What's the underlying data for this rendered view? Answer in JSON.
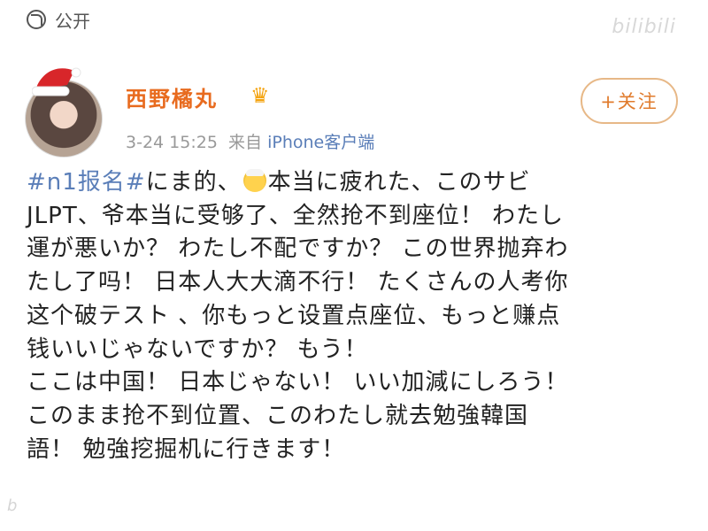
{
  "header": {
    "visibility_icon": "globe-lock-icon",
    "visibility_label": "公开",
    "watermark": "bilibili"
  },
  "user": {
    "name": "西野橘丸",
    "badge_icon": "crown-icon",
    "timestamp": "3-24 15:25",
    "source_prefix": "来自",
    "source": "iPhone客户端",
    "follow_label": "+关注"
  },
  "post": {
    "hashtag": "#n1报名#",
    "emoji": "old-man-face-emoji",
    "line1_a": "にま的、",
    "line1_b": "本当に疲れた、このサビ",
    "line2": "JLPT、爷本当に受够了、全然抢不到座位！ わたし",
    "line3": "運が悪いか？ わたし不配ですか？ この世界抛弃わ",
    "line4": "たし了吗！ 日本人大大滴不行！ たくさんの人考你",
    "line5": "这个破テスト 、你もっと设置点座位、もっと赚点",
    "line6": "钱いいじゃないですか？ もう！",
    "line7": "ここは中国！ 日本じゃない！ いい加減にしろう！",
    "line8": "このまま抢不到位置、このわたし就去勉強韓国",
    "line9": "語！ 勉強挖掘机に行きます！"
  },
  "colors": {
    "name": "#e86b1f",
    "link": "#5a7eb8",
    "follow_border": "#e7b887",
    "muted": "#999999"
  }
}
